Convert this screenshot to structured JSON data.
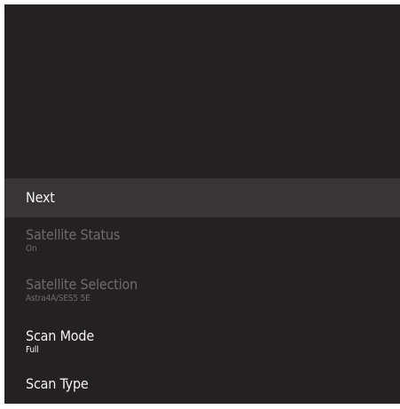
{
  "menu": {
    "next": {
      "label": "Next"
    },
    "satellite_status": {
      "label": "Satellite Status",
      "value": "On"
    },
    "satellite_selection": {
      "label": "Satellite Selection",
      "value": "Astra4A/SES5 5E"
    },
    "scan_mode": {
      "label": "Scan Mode",
      "value": "Full"
    },
    "scan_type": {
      "label": "Scan Type"
    }
  },
  "colors": {
    "background": "#242122",
    "focused_row": "#383536",
    "text_active": "#ffffff",
    "text_disabled": "#6e6b6c"
  }
}
